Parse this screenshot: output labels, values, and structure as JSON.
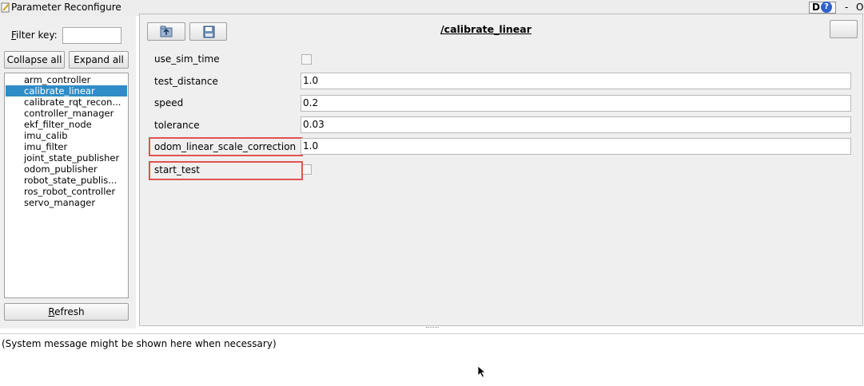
{
  "window": {
    "title": "Parameter Reconfigure",
    "help_d": "D",
    "help_q": "?",
    "minimize": "-",
    "close": "O"
  },
  "left": {
    "filter_label": "Filter key:",
    "filter_value": "",
    "collapse_label": "Collapse all",
    "expand_label": "Expand all",
    "nodes": [
      {
        "label": "arm_controller",
        "selected": false
      },
      {
        "label": "calibrate_linear",
        "selected": true
      },
      {
        "label": "calibrate_rqt_recon...",
        "selected": false
      },
      {
        "label": "controller_manager",
        "selected": false
      },
      {
        "label": "ekf_filter_node",
        "selected": false
      },
      {
        "label": "imu_calib",
        "selected": false
      },
      {
        "label": "imu_filter",
        "selected": false
      },
      {
        "label": "joint_state_publisher",
        "selected": false
      },
      {
        "label": "odom_publisher",
        "selected": false
      },
      {
        "label": "robot_state_publis...",
        "selected": false
      },
      {
        "label": "ros_robot_controller",
        "selected": false
      },
      {
        "label": "servo_manager",
        "selected": false
      }
    ],
    "refresh_label": "Refresh"
  },
  "right": {
    "node_title": "/calibrate_linear",
    "params": {
      "use_sim_time": {
        "label": "use_sim_time",
        "checked": false
      },
      "test_distance": {
        "label": "test_distance",
        "value": "1.0"
      },
      "speed": {
        "label": "speed",
        "value": "0.2"
      },
      "tolerance": {
        "label": "tolerance",
        "value": "0.03"
      },
      "odom_linear_scale_correction": {
        "label": "odom_linear_scale_correction",
        "value": "1.0"
      },
      "start_test": {
        "label": "start_test",
        "checked": false
      }
    }
  },
  "status": {
    "message": "(System message might be shown here when necessary)"
  },
  "colors": {
    "selection": "#308cc6",
    "highlight_box": "#e05252"
  }
}
